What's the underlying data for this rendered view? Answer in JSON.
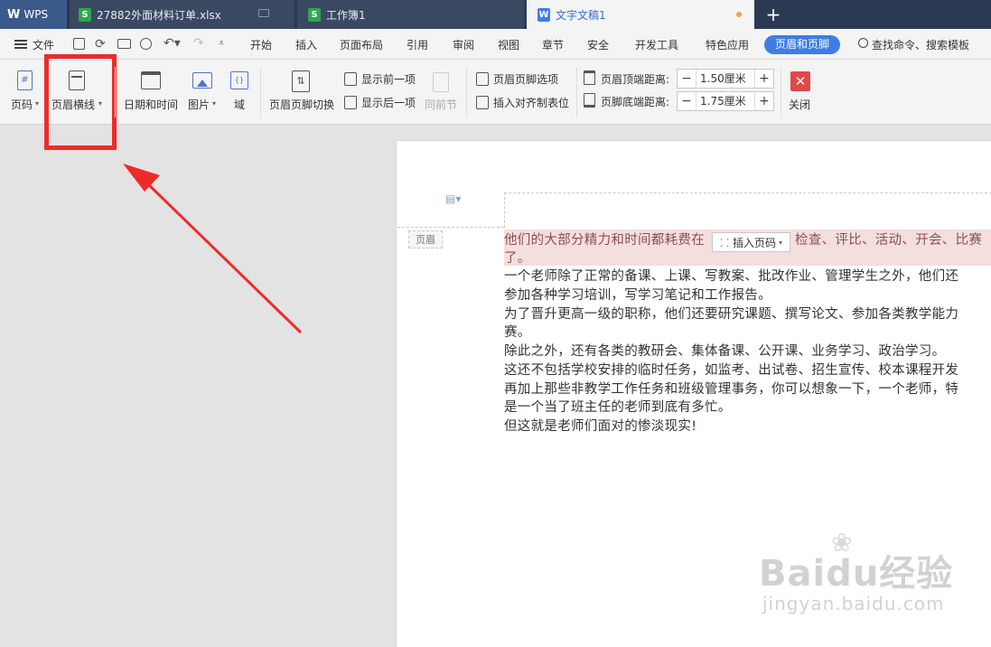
{
  "titlebar": {
    "app": "WPS",
    "tabs": [
      {
        "label": "27882外面材料订单.xlsx"
      },
      {
        "label": "工作簿1"
      },
      {
        "label": "文字文稿1"
      }
    ],
    "new_tab": "+"
  },
  "menubar": {
    "file": "文件",
    "items": [
      "开始",
      "插入",
      "页面布局",
      "引用",
      "审阅",
      "视图",
      "章节",
      "安全",
      "开发工具",
      "特色应用",
      "页眉和页脚"
    ],
    "search": "查找命令、搜索模板"
  },
  "ribbon": {
    "page_number": "页码",
    "header_line": "页眉横线",
    "datetime": "日期和时间",
    "picture": "图片",
    "field": "域",
    "switch": "页眉页脚切换",
    "show_prev": "显示前一项",
    "show_next": "显示后一项",
    "same_as_prev": "同前节",
    "hf_options": "页眉页脚选项",
    "insert_tab": "插入对齐制表位",
    "header_top_label": "页眉顶端距离:",
    "header_top_value": "1.50厘米",
    "footer_bottom_label": "页脚底端距离:",
    "footer_bottom_value": "1.75厘米",
    "close": "关闭"
  },
  "document": {
    "header_tag": "页眉",
    "insert_page_number": "插入页码",
    "lines": [
      "他们的大部分精力和时间都耗费在",
      "检查、评比、活动、开会、比赛",
      "了。",
      "一个老师除了正常的备课、上课、写教案、批改作业、管理学生之外，他们还",
      "参加各种学习培训，写学习笔记和工作报告。",
      "为了晋升更高一级的职称，他们还要研究课题、撰写论文、参加各类教学能力",
      "赛。",
      "除此之外，还有各类的教研会、集体备课、公开课、业务学习、政治学习。",
      "这还不包括学校安排的临时任务，如监考、出试卷、招生宣传、校本课程开发",
      "再加上那些非教学工作任务和班级管理事务，你可以想象一下，一个老师，特",
      "是一个当了班主任的老师到底有多忙。",
      "但这就是老师们面对的惨淡现实!"
    ]
  },
  "watermark": {
    "brand": "Baidu经验",
    "url": "jingyan.baidu.com"
  },
  "colors": {
    "titlebar": "#2b3a52",
    "accent": "#2e6ed8",
    "highlight_box": "#ee2b2b",
    "close_button": "#e04848"
  }
}
